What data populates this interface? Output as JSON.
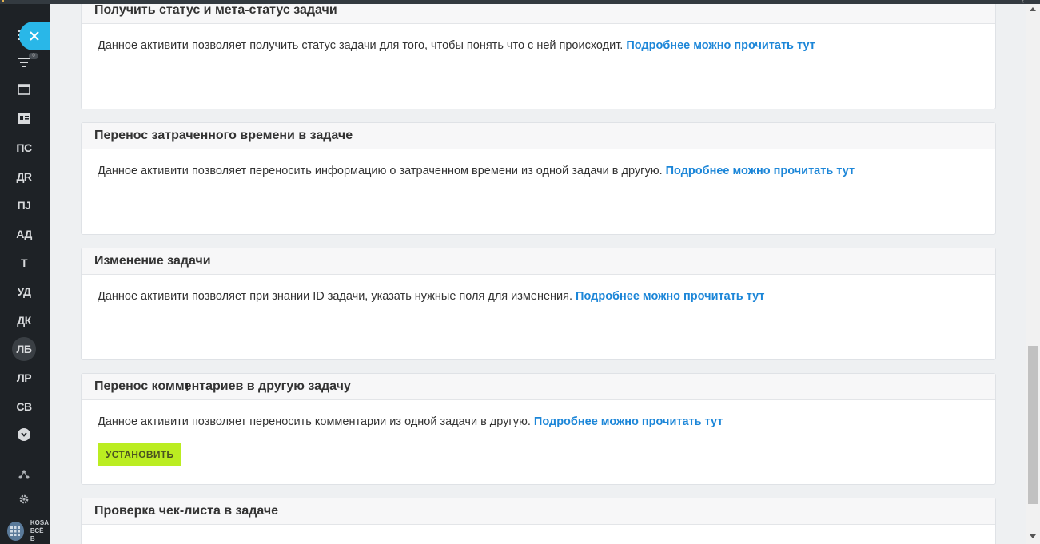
{
  "sidebar": {
    "items": [
      {
        "label": "ПС"
      },
      {
        "label": "ДR"
      },
      {
        "label": "ПJ"
      },
      {
        "label": "АД"
      },
      {
        "label": "Т"
      },
      {
        "label": "УД"
      },
      {
        "label": "ДК"
      },
      {
        "label": "ЛБ"
      },
      {
        "label": "ЛР"
      },
      {
        "label": "СВ"
      }
    ],
    "badge": "0",
    "brand_line1": "KOSA",
    "brand_line2": "ВСЁ В",
    "icons": [
      "menu-icon",
      "filter-icon",
      "window-icon",
      "contact-card-icon",
      "chevron-down-icon",
      "network-icon",
      "gear-icon",
      "brand-logo-icon",
      "close-icon"
    ]
  },
  "cards": [
    {
      "title": "Получить статус и мета-статус задачи",
      "description": "Данное активити позволяет получить статус задачи для того, чтобы понять что с ней происходит.",
      "link": "Подробнее можно прочитать тут"
    },
    {
      "title": "Перенос затраченного времени в задаче",
      "description": "Данное активити позволяет переносить информацию о затраченном времени из одной задачи в другую.",
      "link": "Подробнее можно прочитать тут"
    },
    {
      "title": "Изменение задачи",
      "description": "Данное активити позволяет при знании ID задачи, указать нужные поля для изменения.",
      "link": "Подробнее можно прочитать тут"
    },
    {
      "title": "Перенос комментариев в другую задачу",
      "description": "Данное активити позволяет переносить комментарии из одной задачи в другую.",
      "link": "Подробнее можно прочитать тут",
      "button": "УСТАНОВИТЬ"
    },
    {
      "title": "Проверка чек-листа в задаче"
    }
  ],
  "colors": {
    "link": "#1c86d8",
    "install_button": "#bbed21",
    "sidebar_bg": "#1e2226",
    "close_button": "#29b7e8"
  }
}
